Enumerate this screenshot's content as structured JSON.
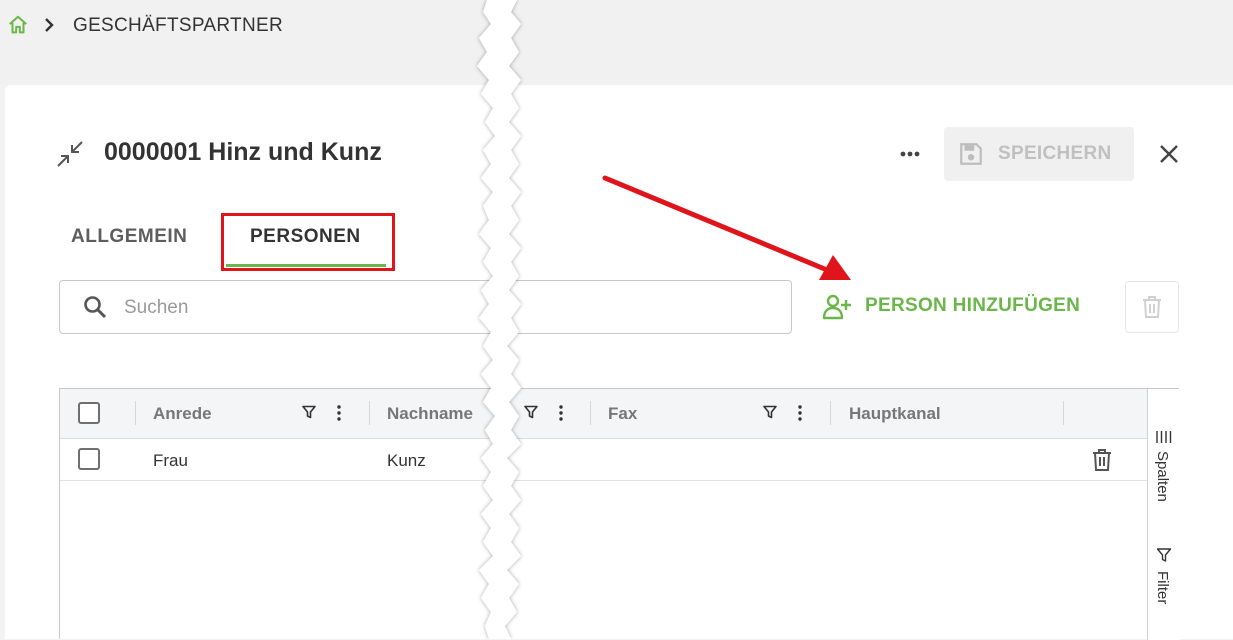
{
  "breadcrumb": {
    "home_icon": "home-icon",
    "separator_icon": "chevron-right-icon",
    "current": "GESCHÄFTSPARTNER"
  },
  "header": {
    "title": "0000001 Hinz und Kunz",
    "save_label": "SPEICHERN",
    "more_icon": "more-horizontal-icon",
    "close_icon": "close-icon"
  },
  "tabs": [
    {
      "label": "ALLGEMEIN",
      "active": false
    },
    {
      "label": "PERSONEN",
      "active": true
    }
  ],
  "search": {
    "placeholder": "Suchen",
    "value": ""
  },
  "actions": {
    "add_person_label": "PERSON HINZUFÜGEN",
    "delete_icon": "trash-icon"
  },
  "grid": {
    "columns": [
      "Anrede",
      "Nachname",
      "Fax",
      "Hauptkanal"
    ],
    "rows": [
      {
        "anrede": "Frau",
        "nachname": "Kunz",
        "fax": "",
        "hauptkanal": ""
      }
    ],
    "side_panel": {
      "columns_label": "Spalten",
      "filter_label": "Filter"
    }
  },
  "colors": {
    "accent": "#6bb64a",
    "annotation": "#e0141b",
    "disabled": "#c0c0c0"
  }
}
